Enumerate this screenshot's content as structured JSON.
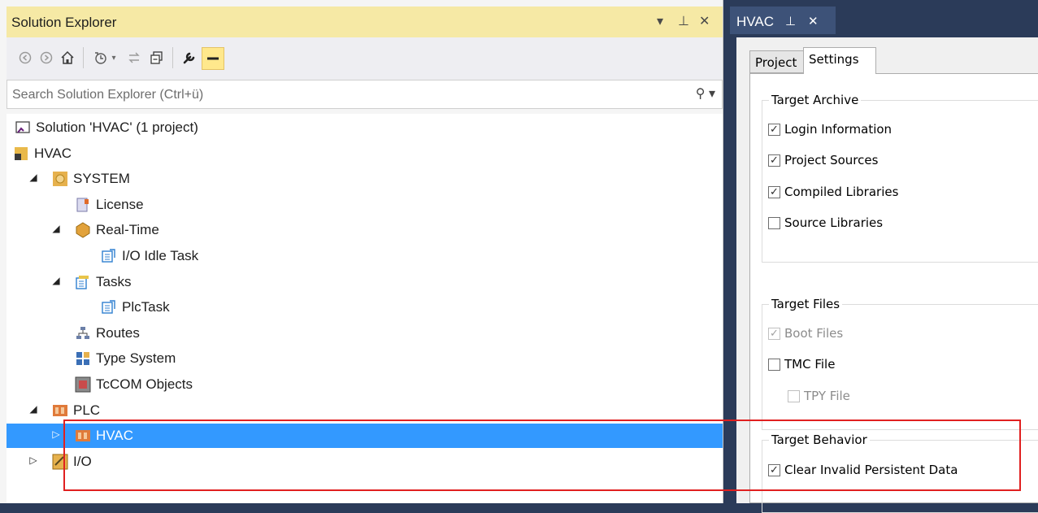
{
  "solution_explorer": {
    "title": "Solution Explorer",
    "controls": {
      "dropdown": "▾",
      "pin": "⊥",
      "close": "✕"
    },
    "search_placeholder": "Search Solution Explorer (Ctrl+ü)",
    "tree": [
      {
        "label": "Solution 'HVAC' (1 project)",
        "icon": "solution-icon",
        "level": 0,
        "expanded": null
      },
      {
        "label": "HVAC",
        "icon": "twincat-project-icon",
        "level": 0,
        "expanded": true
      },
      {
        "label": "SYSTEM",
        "icon": "system-icon",
        "level": 1,
        "expanded": true
      },
      {
        "label": "License",
        "icon": "license-icon",
        "level": 2,
        "expanded": null
      },
      {
        "label": "Real-Time",
        "icon": "realtime-icon",
        "level": 2,
        "expanded": true
      },
      {
        "label": "I/O Idle Task",
        "icon": "task-icon",
        "level": 3,
        "expanded": null
      },
      {
        "label": "Tasks",
        "icon": "tasks-icon",
        "level": 2,
        "expanded": true
      },
      {
        "label": "PlcTask",
        "icon": "task-icon",
        "level": 3,
        "expanded": null
      },
      {
        "label": "Routes",
        "icon": "routes-icon",
        "level": 2,
        "expanded": null
      },
      {
        "label": "Type System",
        "icon": "type-system-icon",
        "level": 2,
        "expanded": null
      },
      {
        "label": "TcCOM Objects",
        "icon": "tccom-icon",
        "level": 2,
        "expanded": null
      },
      {
        "label": "PLC",
        "icon": "plc-icon",
        "level": 1,
        "expanded": true
      },
      {
        "label": "HVAC",
        "icon": "plc-project-icon",
        "level": 2,
        "expanded": false,
        "selected": true
      },
      {
        "label": "I/O",
        "icon": "io-icon",
        "level": 1,
        "expanded": false
      }
    ]
  },
  "editor": {
    "tab_title": "HVAC",
    "tab_pin": "⊥",
    "tab_close": "✕",
    "tabs": [
      "Project",
      "Settings"
    ],
    "active_tab": "Settings",
    "groups": [
      {
        "title": "Target Archive",
        "options": [
          {
            "label": "Login Information",
            "checked": true,
            "enabled": true
          },
          {
            "label": "Project Sources",
            "checked": true,
            "enabled": true
          },
          {
            "label": "Compiled Libraries",
            "checked": true,
            "enabled": true
          },
          {
            "label": "Source Libraries",
            "checked": false,
            "enabled": true
          }
        ]
      },
      {
        "title": "Target Files",
        "options": [
          {
            "label": "Boot Files",
            "checked": true,
            "enabled": false
          },
          {
            "label": "TMC File",
            "checked": false,
            "enabled": true
          },
          {
            "label": "TPY File",
            "checked": false,
            "enabled": false
          }
        ]
      },
      {
        "title": "Target Behavior",
        "options": [
          {
            "label": "Clear Invalid Persistent Data",
            "checked": true,
            "enabled": true
          }
        ]
      }
    ]
  },
  "colors": {
    "selection": "#3399ff",
    "title_bar": "#f6e9a5",
    "highlight_box": "#e02020",
    "frame": "#2b3b59"
  }
}
